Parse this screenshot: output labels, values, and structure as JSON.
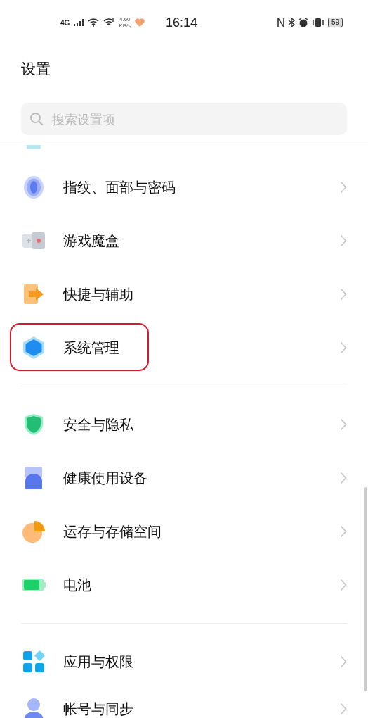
{
  "status_bar": {
    "network": "4G",
    "speed_value": "4.60",
    "speed_unit": "KB/s",
    "time": "16:14",
    "battery": "59"
  },
  "title": "设置",
  "search": {
    "placeholder": "搜索设置项"
  },
  "groups": [
    {
      "items": [
        {
          "kind": "fingerprint",
          "label": "指纹、面部与密码",
          "highlighted": false
        },
        {
          "kind": "game",
          "label": "游戏魔盒",
          "highlighted": false
        },
        {
          "kind": "shortcut",
          "label": "快捷与辅助",
          "highlighted": false
        },
        {
          "kind": "hexagon",
          "label": "系统管理",
          "highlighted": true
        }
      ]
    },
    {
      "items": [
        {
          "kind": "shield",
          "label": "安全与隐私",
          "highlighted": false
        },
        {
          "kind": "health",
          "label": "健康使用设备",
          "highlighted": false
        },
        {
          "kind": "storage",
          "label": "运存与存储空间",
          "highlighted": false
        },
        {
          "kind": "battery",
          "label": "电池",
          "highlighted": false
        }
      ]
    },
    {
      "items": [
        {
          "kind": "apps",
          "label": "应用与权限",
          "highlighted": false
        },
        {
          "kind": "account",
          "label": "帐号与同步",
          "highlighted": false
        }
      ]
    }
  ]
}
